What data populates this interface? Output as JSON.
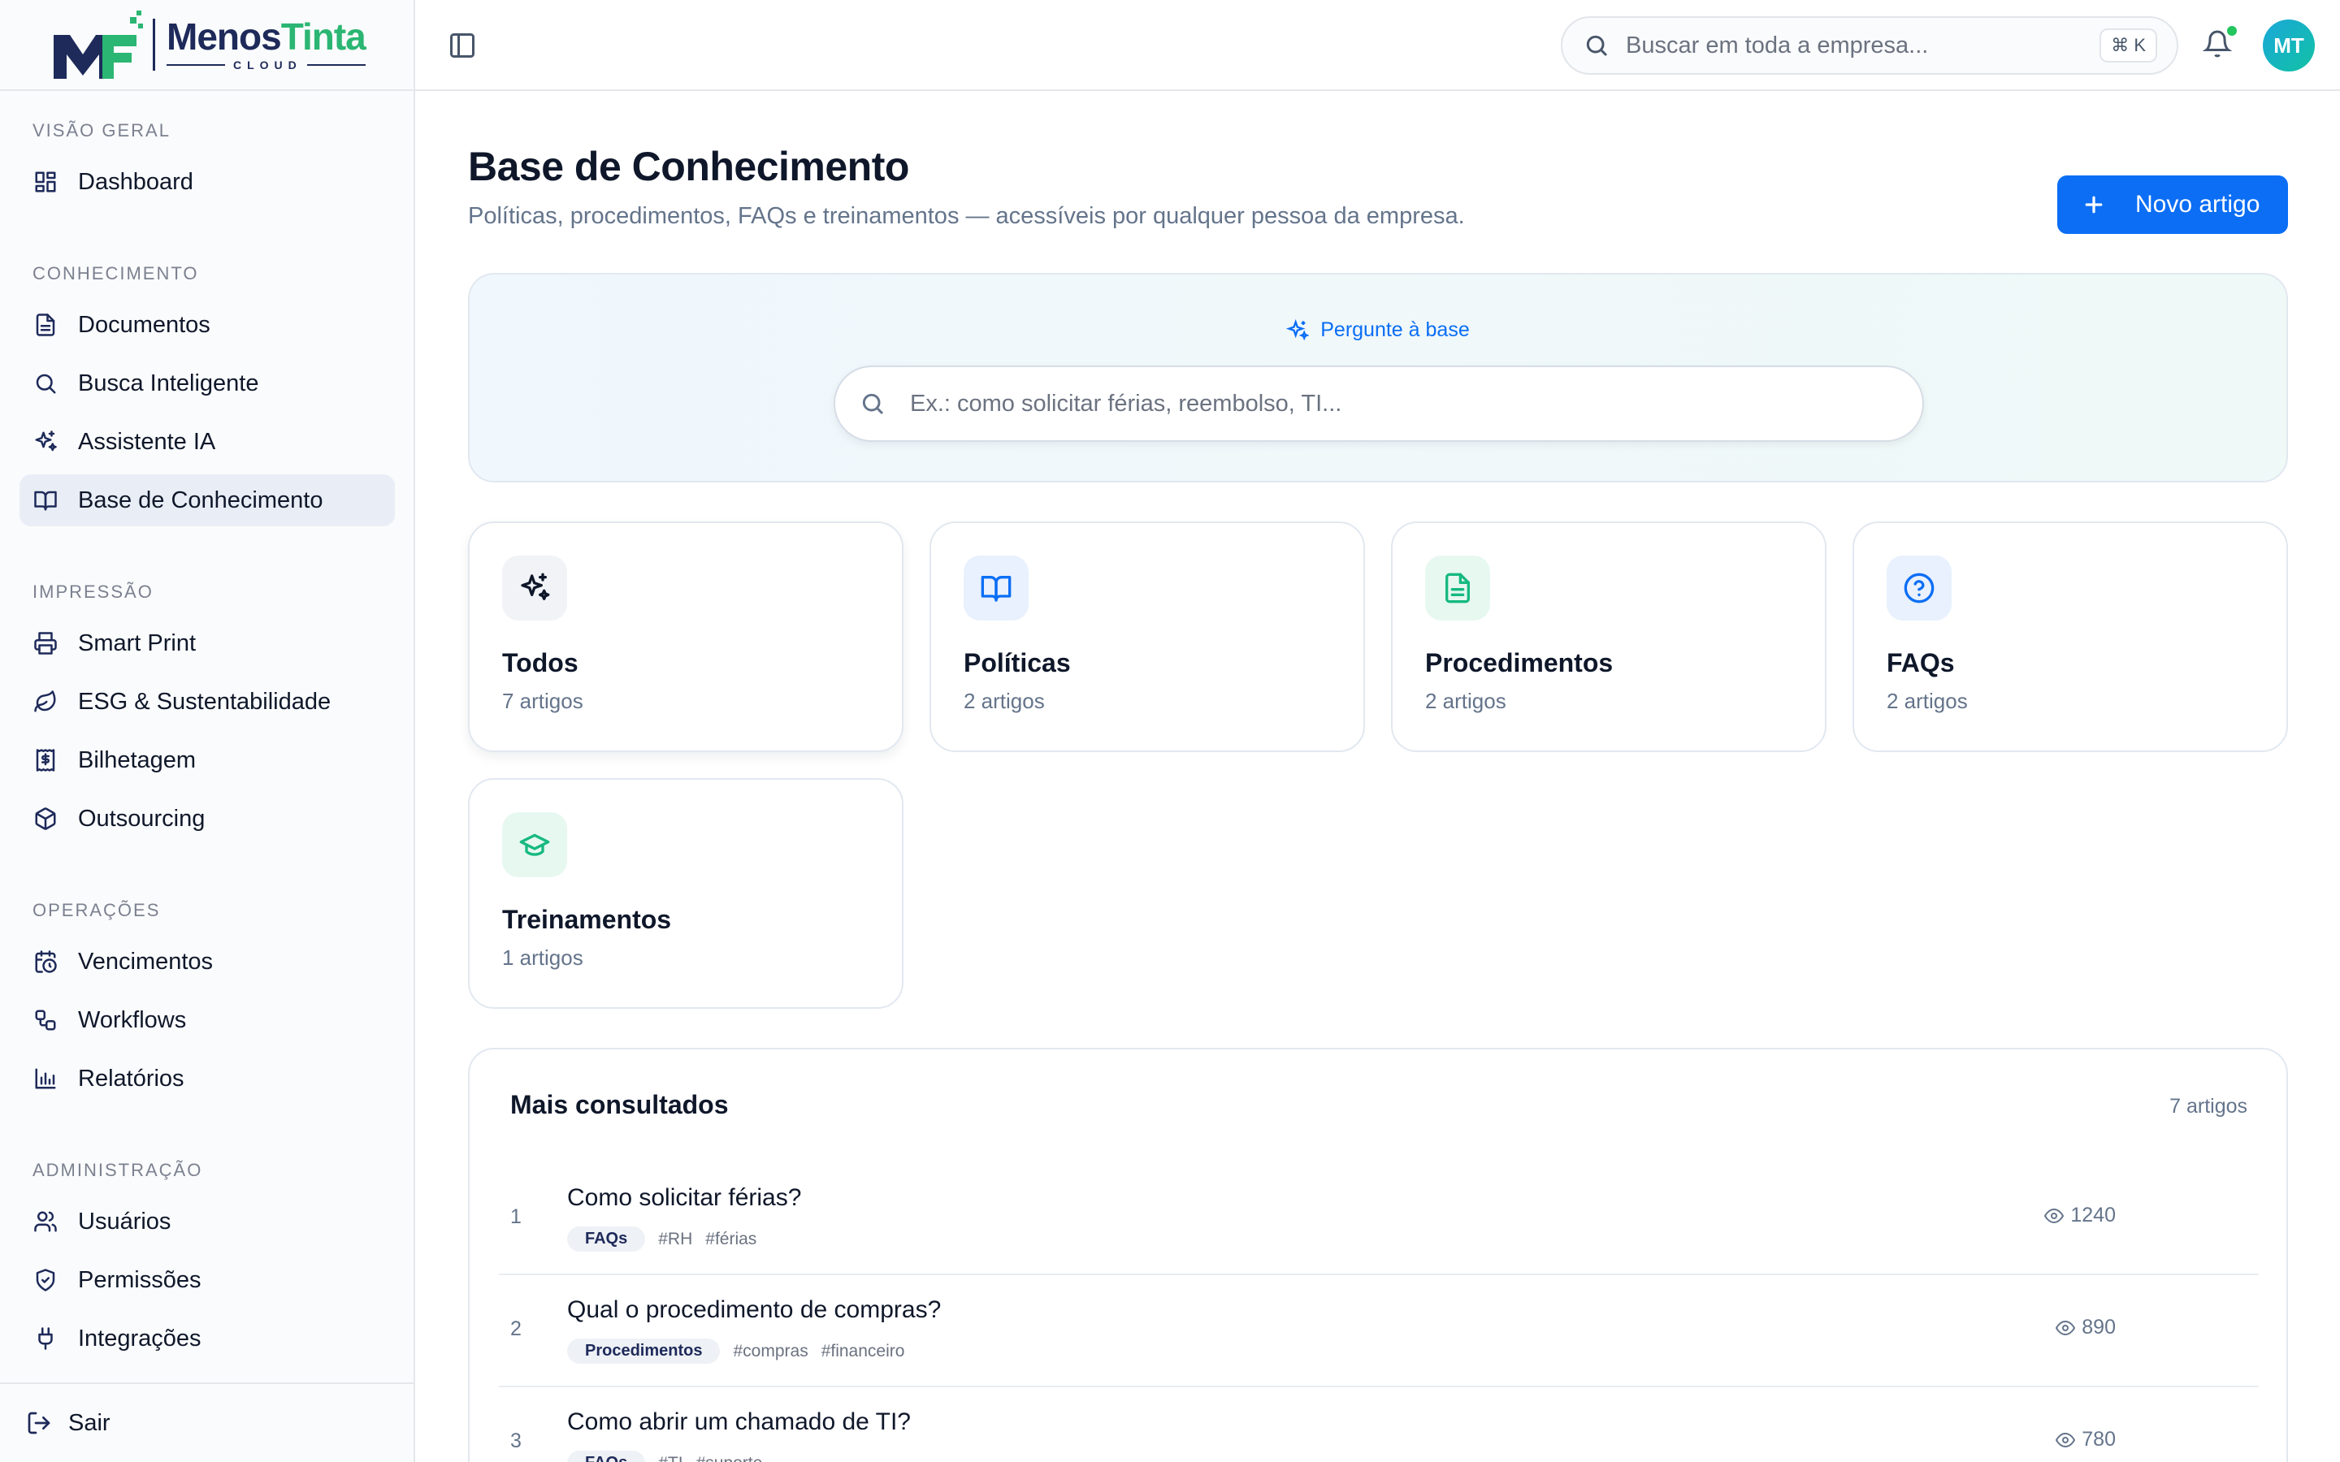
{
  "brand": {
    "name_part1": "Menos",
    "name_part2": "Tinta",
    "sub": "CLOUD"
  },
  "sidebar": {
    "sections": [
      {
        "title": "Visão geral",
        "items": [
          {
            "label": "Dashboard",
            "icon": "dashboard-icon"
          }
        ]
      },
      {
        "title": "Conhecimento",
        "items": [
          {
            "label": "Documentos",
            "icon": "file-text-icon"
          },
          {
            "label": "Busca Inteligente",
            "icon": "search-icon"
          },
          {
            "label": "Assistente IA",
            "icon": "sparkles-icon"
          },
          {
            "label": "Base de Conhecimento",
            "icon": "book-open-icon",
            "active": true
          }
        ]
      },
      {
        "title": "Impressão",
        "items": [
          {
            "label": "Smart Print",
            "icon": "printer-icon"
          },
          {
            "label": "ESG & Sustentabilidade",
            "icon": "leaf-icon"
          },
          {
            "label": "Bilhetagem",
            "icon": "receipt-icon"
          },
          {
            "label": "Outsourcing",
            "icon": "package-icon"
          }
        ]
      },
      {
        "title": "Operações",
        "items": [
          {
            "label": "Vencimentos",
            "icon": "calendar-clock-icon"
          },
          {
            "label": "Workflows",
            "icon": "workflow-icon"
          },
          {
            "label": "Relatórios",
            "icon": "bar-chart-icon"
          }
        ]
      },
      {
        "title": "Administração",
        "items": [
          {
            "label": "Usuários",
            "icon": "users-icon"
          },
          {
            "label": "Permissões",
            "icon": "shield-check-icon"
          },
          {
            "label": "Integrações",
            "icon": "plug-icon"
          }
        ]
      }
    ],
    "logout_label": "Sair"
  },
  "topbar": {
    "search_placeholder": "Buscar em toda a empresa...",
    "shortcut": "⌘ K",
    "avatar_initials": "MT"
  },
  "header": {
    "title": "Base de Conhecimento",
    "subtitle": "Políticas, procedimentos, FAQs e treinamentos — acessíveis por qualquer pessoa da empresa.",
    "new_button": "Novo artigo"
  },
  "ask": {
    "label": "Pergunte à base",
    "placeholder": "Ex.: como solicitar férias, reembolso, TI..."
  },
  "categories": [
    {
      "name": "Todos",
      "count": "7 artigos",
      "icon": "sparkles-icon",
      "color": "#0f172a",
      "bg": "#f1f3f6"
    },
    {
      "name": "Políticas",
      "count": "2 artigos",
      "icon": "book-open-icon",
      "color": "#0b6ef5",
      "bg": "#e8f1fd"
    },
    {
      "name": "Procedimentos",
      "count": "2 artigos",
      "icon": "file-text-icon",
      "color": "#16b981",
      "bg": "#e7f8f1"
    },
    {
      "name": "FAQs",
      "count": "2 artigos",
      "icon": "help-circle-icon",
      "color": "#0b6ef5",
      "bg": "#e8f1fd"
    },
    {
      "name": "Treinamentos",
      "count": "1 artigos",
      "icon": "graduation-cap-icon",
      "color": "#16b981",
      "bg": "#e7f8f1"
    }
  ],
  "popular": {
    "title": "Mais consultados",
    "count": "7 artigos",
    "rows": [
      {
        "rank": "1",
        "title": "Como solicitar férias?",
        "badge": "FAQs",
        "tags": [
          "#RH",
          "#férias"
        ],
        "views": "1240"
      },
      {
        "rank": "2",
        "title": "Qual o procedimento de compras?",
        "badge": "Procedimentos",
        "tags": [
          "#compras",
          "#financeiro"
        ],
        "views": "890"
      },
      {
        "rank": "3",
        "title": "Como abrir um chamado de TI?",
        "badge": "FAQs",
        "tags": [
          "#TI",
          "#suporte"
        ],
        "views": "780"
      }
    ]
  }
}
